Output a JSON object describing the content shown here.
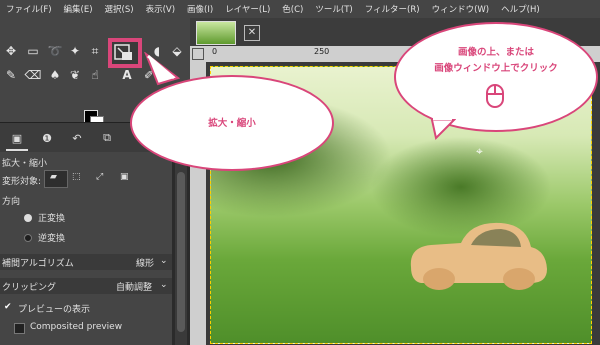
{
  "menu": [
    "ファイル(F)",
    "編集(E)",
    "選択(S)",
    "表示(V)",
    "画像(I)",
    "レイヤー(L)",
    "色(C)",
    "ツール(T)",
    "フィルター(R)",
    "ウィンドウ(W)",
    "ヘルプ(H)"
  ],
  "ruler": {
    "top_marks": [
      "0",
      "250"
    ]
  },
  "options": {
    "title": "拡大・縮小",
    "transform_target_label": "変形対象:",
    "direction_label": "方向",
    "forward_label": "正変換",
    "reverse_label": "逆変換",
    "interpolation_label": "補間アルゴリズム",
    "interpolation_value": "線形",
    "clipping_label": "クリッピング",
    "clipping_value": "自動調整",
    "preview_label": "プレビューの表示",
    "composited_label": "Composited preview"
  },
  "callouts": {
    "tool_name": "拡大・縮小",
    "instruction_line1": "画像の上、または",
    "instruction_line2": "画像ウィンドウ上でクリック"
  },
  "colors": {
    "accent": "#d9467a",
    "selection": "#ffd000"
  }
}
